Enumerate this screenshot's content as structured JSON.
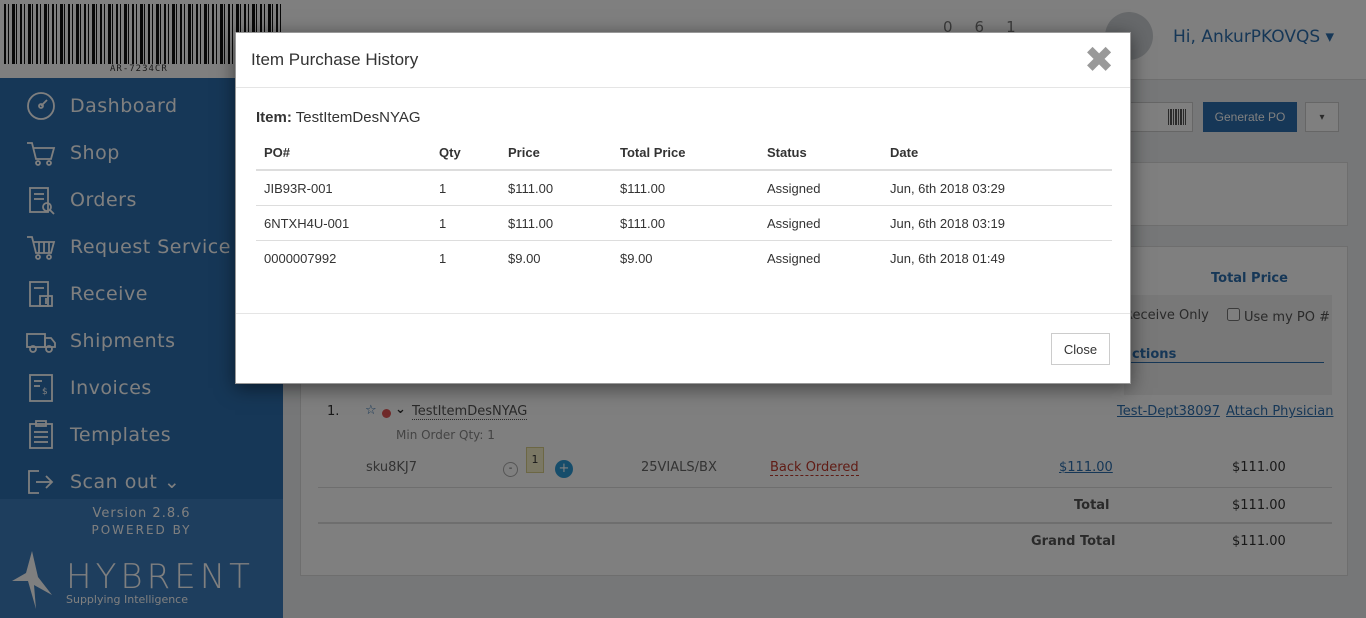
{
  "sidebar": {
    "barcode_text": "AR-7234CR",
    "items": [
      {
        "label": "Dashboard",
        "icon": "dashboard-icon"
      },
      {
        "label": "Shop",
        "icon": "cart-icon"
      },
      {
        "label": "Orders",
        "icon": "orders-icon"
      },
      {
        "label": "Request Service",
        "icon": "request-service-icon"
      },
      {
        "label": "Receive",
        "icon": "receive-icon"
      },
      {
        "label": "Shipments",
        "icon": "truck-icon"
      },
      {
        "label": "Invoices",
        "icon": "invoice-icon"
      },
      {
        "label": "Templates",
        "icon": "templates-icon"
      },
      {
        "label": "Scan out ⌄",
        "icon": "scan-out-icon"
      }
    ],
    "version": "Version 2.8.6",
    "powered_by": "POWERED BY",
    "brand_name": "HYBRENT",
    "brand_tagline": "Supplying Intelligence"
  },
  "header": {
    "counts": [
      "0",
      "6",
      "1"
    ],
    "greeting": "Hi, AnkurPKOVQS ▾"
  },
  "main": {
    "generate_po_label": "Generate PO",
    "caret": "▾",
    "total_price_header": "Total Price",
    "receive_only_label": "Receive Only",
    "use_my_po_label": "Use my PO #",
    "actions_label": "ctions",
    "line_item": {
      "number": "1.",
      "star": "☆",
      "chevron": "⌄",
      "name": "TestItemDesNYAG",
      "min_order": "Min Order Qty: 1",
      "dept_link": "Test-Dept38097",
      "physician_link": "Attach Physician",
      "sku": "sku8KJ7",
      "minus": "-",
      "qty": "1",
      "plus": "+",
      "uom": "25VIALS/BX",
      "status": "Back Ordered",
      "unit_price": "$111.00",
      "line_total": "$111.00"
    },
    "total_label": "Total",
    "total_value": "$111.00",
    "grand_total_label": "Grand Total",
    "grand_total_value": "$111.00"
  },
  "modal": {
    "title": "Item Purchase History",
    "close_x": "✖",
    "item_label": "Item:",
    "item_name": "TestItemDesNYAG",
    "columns": [
      "PO#",
      "Qty",
      "Price",
      "Total Price",
      "Status",
      "Date"
    ],
    "rows": [
      [
        "JIB93R-001",
        "1",
        "$111.00",
        "$111.00",
        "Assigned",
        "Jun, 6th 2018 03:29"
      ],
      [
        "6NTXH4U-001",
        "1",
        "$111.00",
        "$111.00",
        "Assigned",
        "Jun, 6th 2018 03:19"
      ],
      [
        "0000007992",
        "1",
        "$9.00",
        "$9.00",
        "Assigned",
        "Jun, 6th 2018 01:49"
      ]
    ],
    "close_label": "Close"
  }
}
